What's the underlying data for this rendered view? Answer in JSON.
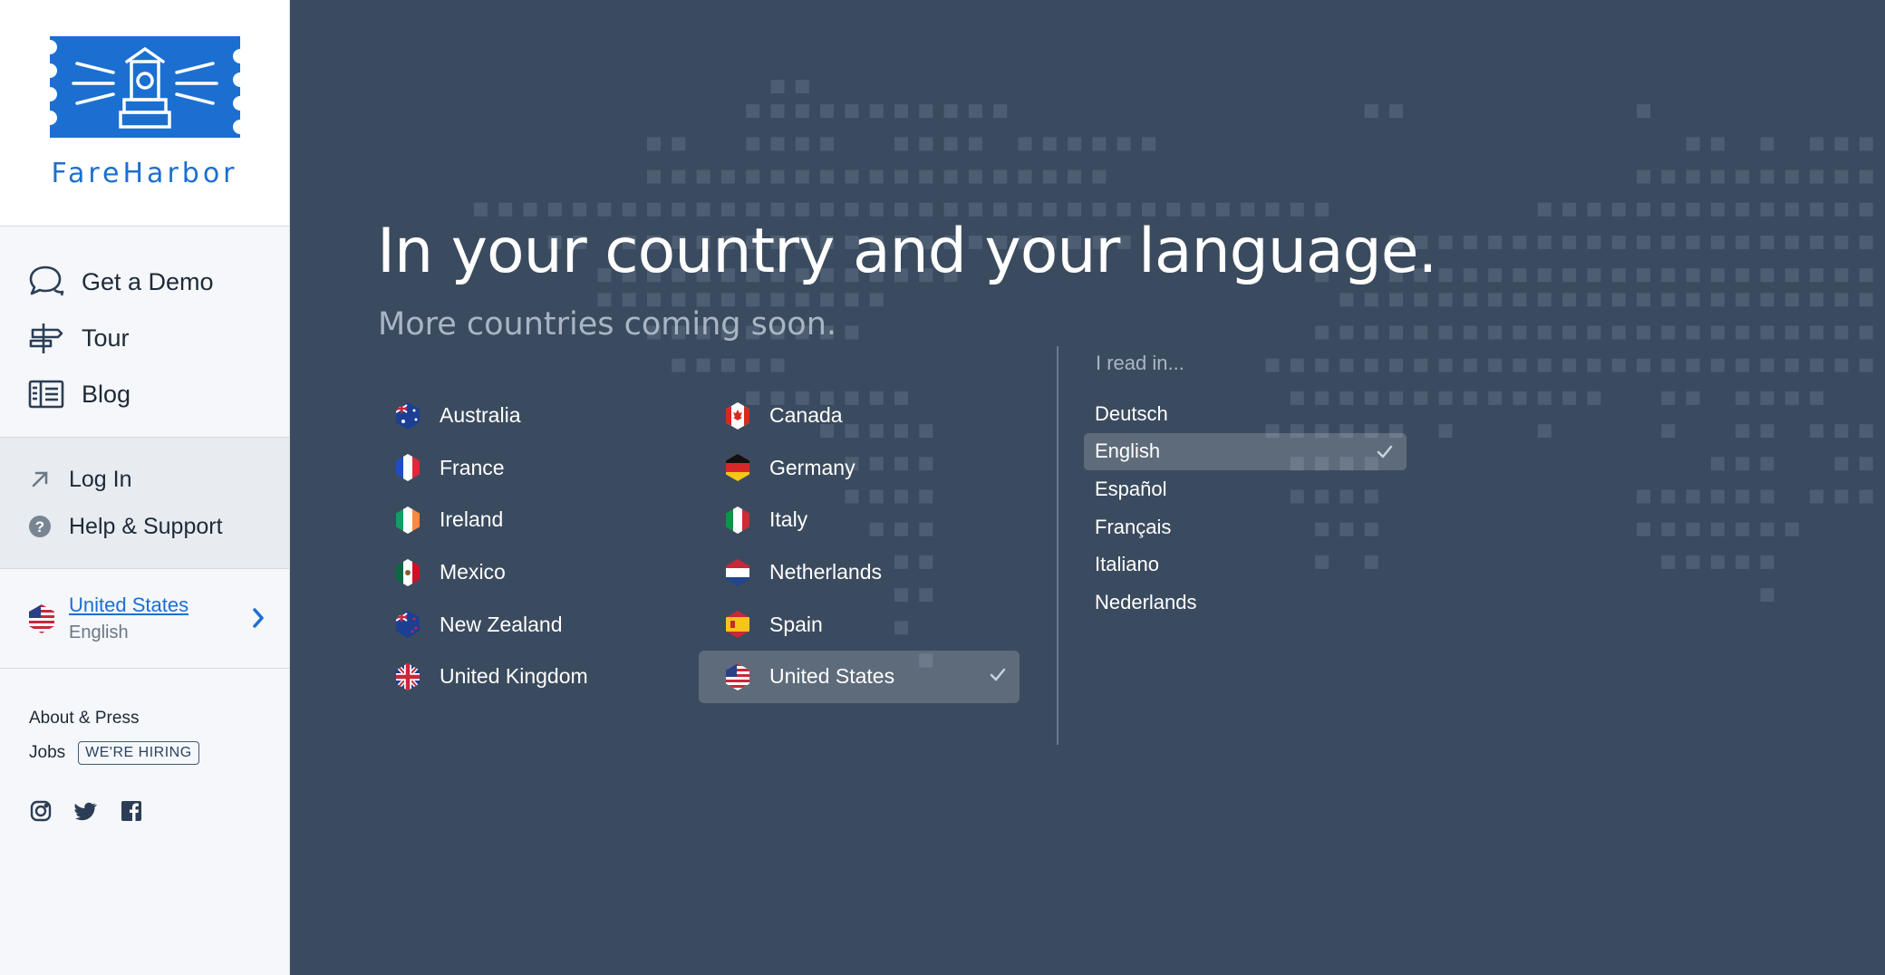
{
  "brand": {
    "name": "FareHarbor"
  },
  "sidebar": {
    "nav": [
      {
        "label": "Get a Demo",
        "icon": "chat-bubbles-icon"
      },
      {
        "label": "Tour",
        "icon": "signpost-icon"
      },
      {
        "label": "Blog",
        "icon": "book-icon"
      }
    ],
    "secondary": [
      {
        "label": "Log In",
        "icon": "arrow-up-right-icon"
      },
      {
        "label": "Help & Support",
        "icon": "question-circle-icon"
      }
    ],
    "locale": {
      "country": "United States",
      "language": "English"
    },
    "footer": {
      "about": "About & Press",
      "jobs": "Jobs",
      "hiring_badge": "WE'RE HIRING"
    },
    "social": [
      "instagram-icon",
      "twitter-icon",
      "facebook-icon"
    ]
  },
  "main": {
    "headline": "In your country and your language.",
    "subhead": "More countries coming soon.",
    "countries": [
      {
        "name": "Australia",
        "flag": "au"
      },
      {
        "name": "Canada",
        "flag": "ca"
      },
      {
        "name": "France",
        "flag": "fr"
      },
      {
        "name": "Germany",
        "flag": "de"
      },
      {
        "name": "Ireland",
        "flag": "ie"
      },
      {
        "name": "Italy",
        "flag": "it"
      },
      {
        "name": "Mexico",
        "flag": "mx"
      },
      {
        "name": "Netherlands",
        "flag": "nl"
      },
      {
        "name": "New Zealand",
        "flag": "nz"
      },
      {
        "name": "Spain",
        "flag": "es"
      },
      {
        "name": "United Kingdom",
        "flag": "gb"
      },
      {
        "name": "United States",
        "flag": "us",
        "selected": true
      }
    ],
    "language_label": "I read in...",
    "languages": [
      {
        "name": "Deutsch"
      },
      {
        "name": "English",
        "selected": true
      },
      {
        "name": "Español"
      },
      {
        "name": "Français"
      },
      {
        "name": "Italiano"
      },
      {
        "name": "Nederlands"
      }
    ]
  },
  "colors": {
    "brand_blue": "#1b6fd1",
    "main_bg": "#3b4b5f",
    "sidebar_bg": "#f5f7fa"
  }
}
